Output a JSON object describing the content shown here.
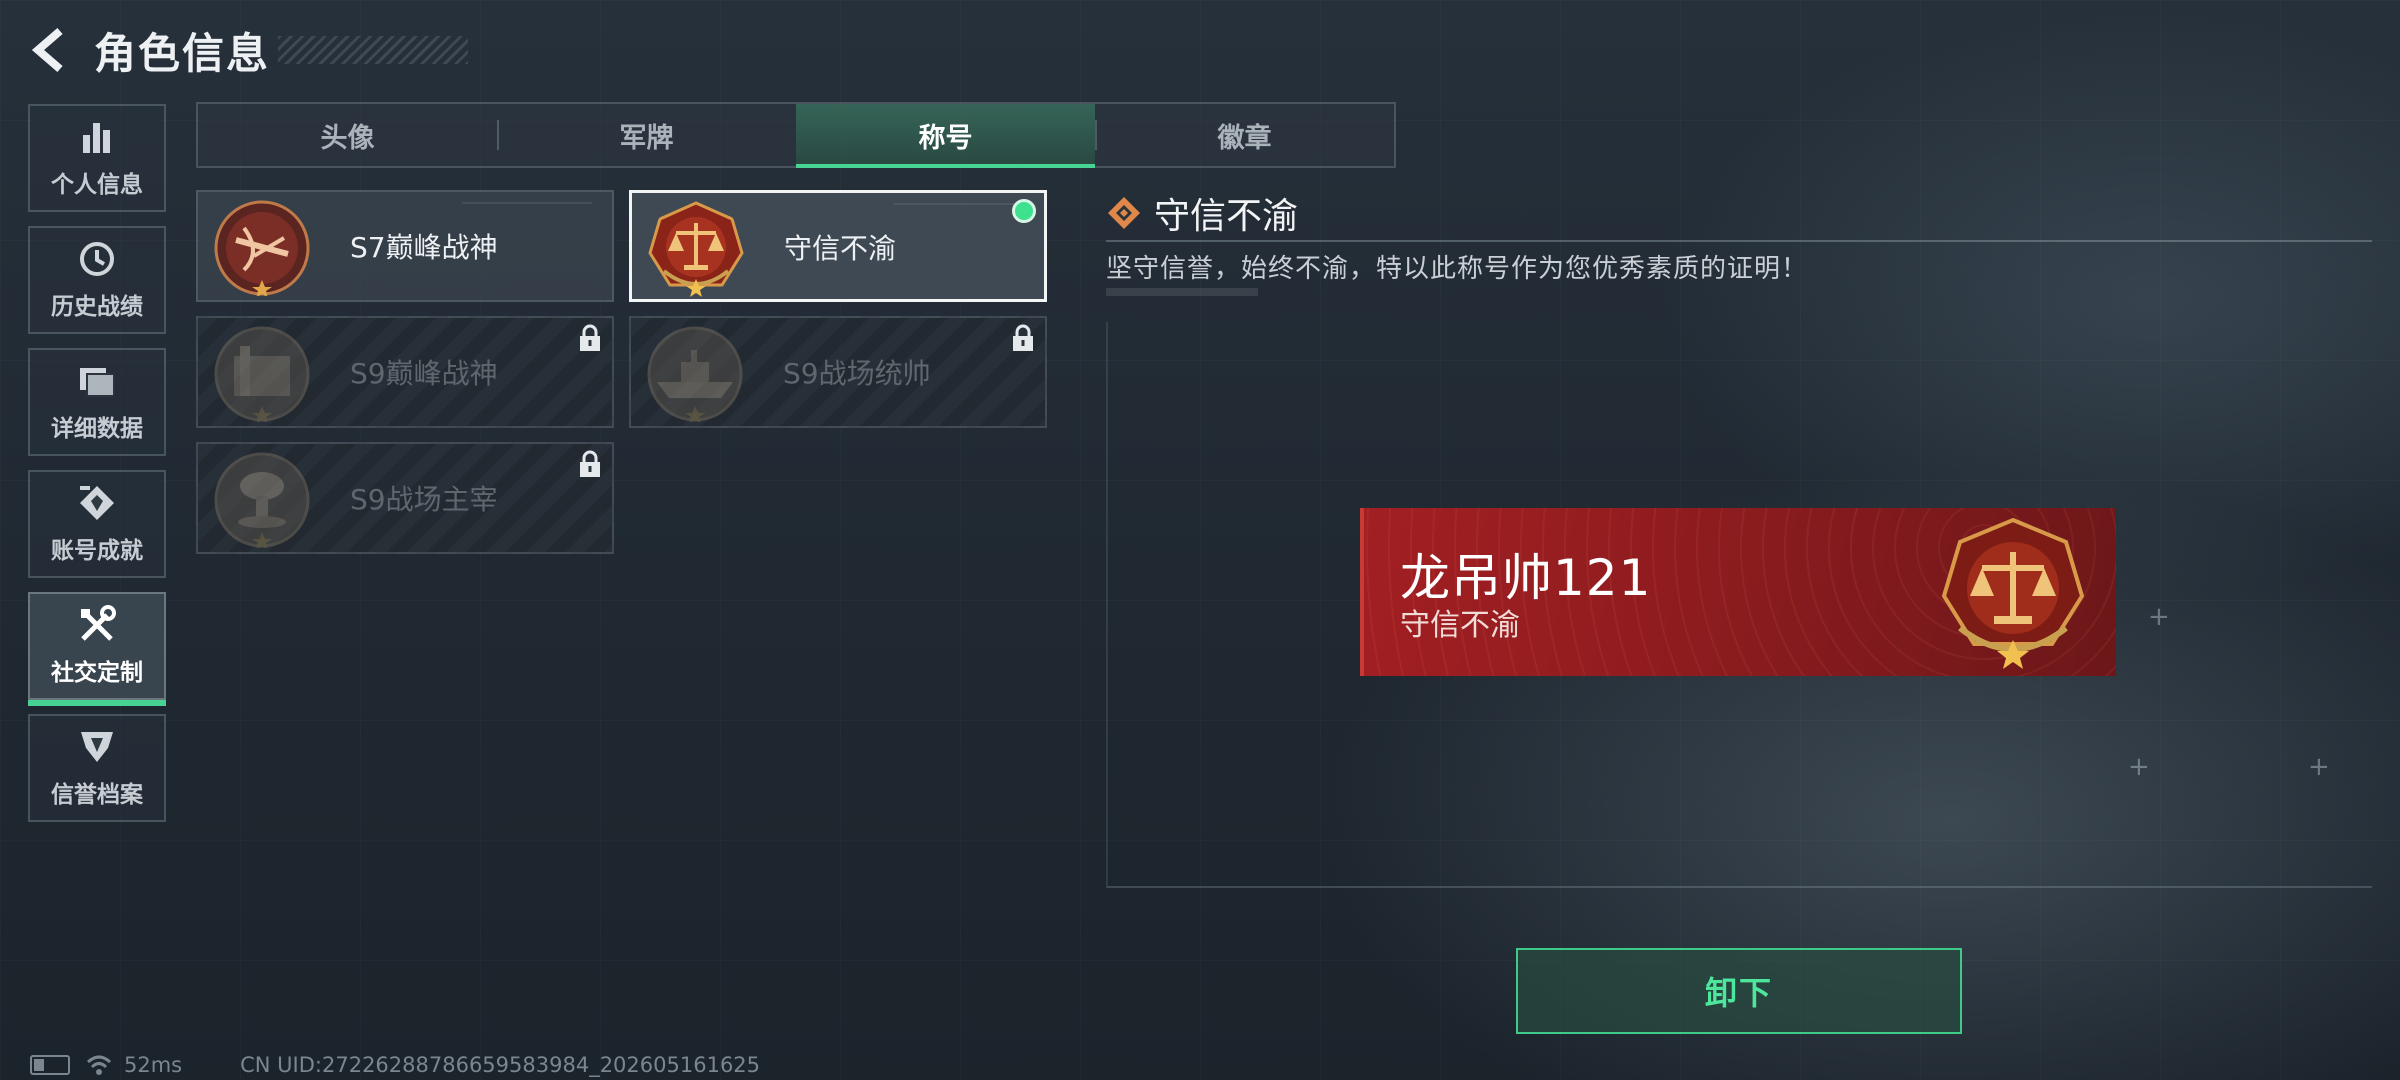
{
  "header": {
    "title": "角色信息"
  },
  "sidebar": {
    "items": [
      {
        "label": "个人信息",
        "icon": "bar-chart-icon"
      },
      {
        "label": "历史战绩",
        "icon": "history-icon"
      },
      {
        "label": "详细数据",
        "icon": "folder-icon"
      },
      {
        "label": "账号成就",
        "icon": "achievement-icon"
      },
      {
        "label": "社交定制",
        "icon": "tools-icon",
        "active": true
      },
      {
        "label": "信誉档案",
        "icon": "shield-badge-icon"
      }
    ]
  },
  "tabs": [
    {
      "label": "头像"
    },
    {
      "label": "军牌"
    },
    {
      "label": "称号",
      "active": true
    },
    {
      "label": "徽章"
    }
  ],
  "titles": [
    {
      "label": "S7巅峰战神",
      "locked": false,
      "medal": "crossbow-medal-icon"
    },
    {
      "label": "守信不渝",
      "locked": false,
      "selected": true,
      "equipped": true,
      "medal": "scales-medal-icon"
    },
    {
      "label": "S9巅峰战神",
      "locked": true,
      "medal": "fortress-medal-icon"
    },
    {
      "label": "S9战场统帅",
      "locked": true,
      "medal": "warship-medal-icon"
    },
    {
      "label": "S9战场主宰",
      "locked": true,
      "medal": "mushroom-cloud-medal-icon"
    }
  ],
  "detail": {
    "title": "守信不渝",
    "description": "坚守信誉，始终不渝，特以此称号作为您优秀素质的证明！"
  },
  "banner": {
    "player_name": "龙吊帅121",
    "title": "守信不渝"
  },
  "actions": {
    "unequip_label": "卸下"
  },
  "footer": {
    "ping": "52ms",
    "uid": "CN UID:272262887866595839​84_202605161625"
  },
  "colors": {
    "accent_green": "#46d394",
    "banner_red": "#a21f22",
    "medal_bronze": "#c8863a"
  }
}
